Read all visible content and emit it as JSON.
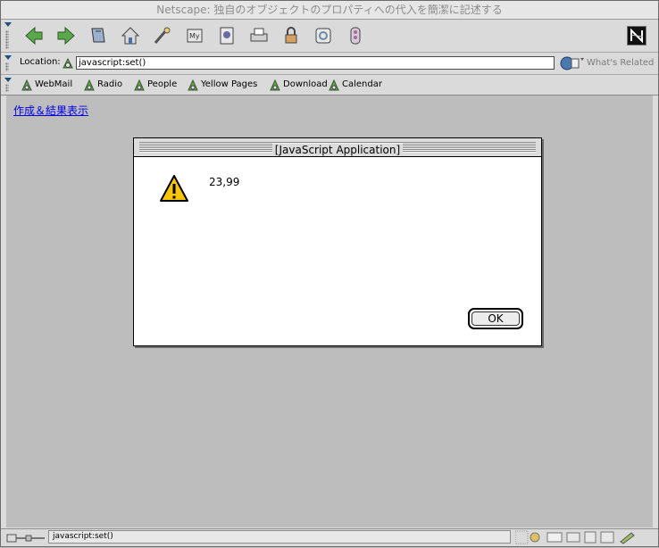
{
  "window": {
    "title": "Netscape: 独自のオブジェクトのプロパティへの代入を簡潔に記述する"
  },
  "toolbar": {
    "buttons": [
      {
        "name": "back-button",
        "icon": "back-arrow-icon",
        "color": "#5aa84a"
      },
      {
        "name": "forward-button",
        "icon": "forward-arrow-icon",
        "color": "#5aa84a"
      },
      {
        "name": "reload-button",
        "icon": "reload-icon",
        "color": "#4a6fa8"
      },
      {
        "name": "home-button",
        "icon": "home-icon",
        "color": "#4a6fa8"
      },
      {
        "name": "search-button",
        "icon": "search-icon",
        "color": "#a85a5a"
      },
      {
        "name": "my-netscape-button",
        "icon": "my-netscape-icon",
        "color": "#6a6aa8",
        "text": "My"
      },
      {
        "name": "images-button",
        "icon": "images-icon",
        "color": "#6a6aa8"
      },
      {
        "name": "print-button",
        "icon": "print-icon",
        "color": "#6a8aa8"
      },
      {
        "name": "security-button",
        "icon": "lock-icon",
        "color": "#a86a6a"
      },
      {
        "name": "shop-button",
        "icon": "shop-icon",
        "color": "#6a8aa8"
      },
      {
        "name": "stop-button",
        "icon": "stop-icon",
        "color": "#a86a9a"
      }
    ],
    "logo_icon": "netscape-logo-icon"
  },
  "location": {
    "label": "Location:",
    "value": "javascript:set()",
    "related_label": "What's Related"
  },
  "personal_toolbar": {
    "items": [
      "WebMail",
      "Radio",
      "People",
      "Yellow Pages",
      "Download",
      "Calendar"
    ]
  },
  "page": {
    "link_text": "作成＆結果表示",
    "link_color": "#0000ee"
  },
  "dialog": {
    "title": "[JavaScript Application]",
    "message": "23,99",
    "ok_label": "OK",
    "icon": "warning-icon"
  },
  "status": {
    "text": "javascript:set()"
  },
  "colors": {
    "chrome": "#dadada",
    "content_bg": "#bdbdbd",
    "warning_yellow": "#f7c600"
  }
}
